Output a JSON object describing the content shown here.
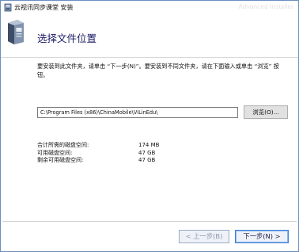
{
  "window": {
    "title": "云视讯同步课堂 安装",
    "watermark": "Advanced Installer"
  },
  "header": {
    "heading": "选择文件位置"
  },
  "content": {
    "instructions": "要安装到此文件夹，请单击 “下一步(N)”。要安装到不同文件夹，请在下面输入或单击 “浏览” 按钮。",
    "install_path": "C:\\Program Files (x86)\\ChinaMobile\\ViLinEdu\\",
    "browse_label": "浏览(O)...",
    "disk_space": [
      {
        "label": "合计所需的磁盘空间:",
        "value": "174 MB"
      },
      {
        "label": "可用磁盘空间:",
        "value": "47 GB"
      },
      {
        "label": "剩余可用磁盘空间:",
        "value": "47 GB"
      }
    ]
  },
  "footer": {
    "back_label": "< 上一步(B)",
    "next_label": "下一步(N) >"
  },
  "icons": {
    "app": "installer-app-icon",
    "wizard": "installer-box-icon"
  }
}
